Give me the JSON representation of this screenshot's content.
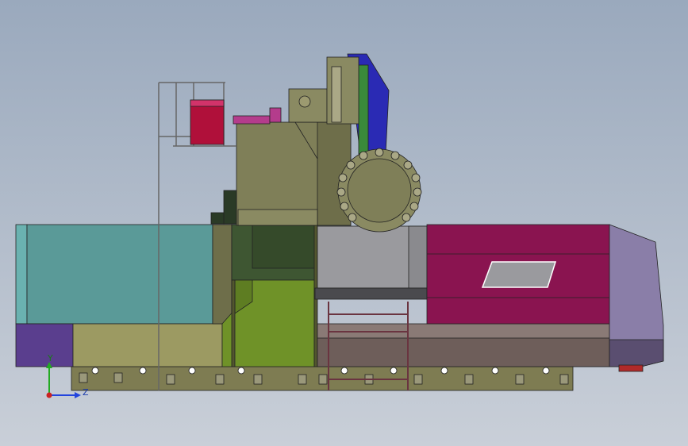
{
  "viewport": {
    "background_top": "#9aa9bd",
    "background_bottom": "#c9cfd8"
  },
  "triad": {
    "y_label": "Y",
    "z_label": "Z",
    "y_color": "#22aa22",
    "z_color": "#2244dd",
    "origin_color": "#cc2222"
  },
  "colors": {
    "teal_panel": "#5a9a98",
    "teal_edge": "#6ab2b0",
    "dark_green": "#3e5632",
    "olive": "#7f7f58",
    "khaki": "#9c9a62",
    "lime": "#6f9228",
    "gray_block": "#9a9a9e",
    "magenta": "#8a1450",
    "lavender": "#8a7ea8",
    "purple": "#5a3e8e",
    "mauve_base": "#8a7a76",
    "base_rail": "#7e7c52",
    "head_blue": "#2a2ab4",
    "head_green": "#3a8a3a",
    "red_block": "#b0103a",
    "ladder": "#6a3440"
  }
}
